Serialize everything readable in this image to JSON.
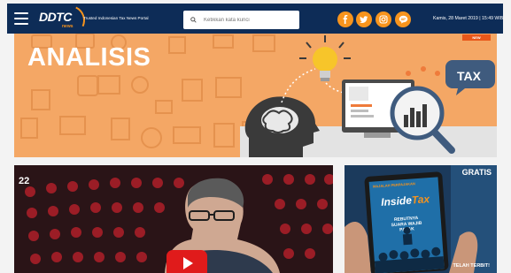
{
  "header": {
    "logo_text": "DDTC",
    "logo_sub": "news",
    "tagline": "Trusted Indonesian Tax News Portal",
    "search_placeholder": "Ketikkan kata kunci",
    "datetime": "Kamis, 28 Maret 2019 | 15:49 WIB",
    "social": [
      "facebook-icon",
      "twitter-icon",
      "instagram-icon",
      "line-icon"
    ]
  },
  "banner": {
    "title": "ANALISIS",
    "badge": "NEW",
    "tax_bubble": "TAX"
  },
  "video": {
    "episode": "22"
  },
  "ad": {
    "gratis": "GRATIS",
    "magazine_tag": "MAJALAH PERPAJAKAN",
    "brand_main": "Inside",
    "brand_accent": "Tax",
    "headline": "REBUTNYA SUARA WAJIB PAJAK",
    "terbit": "TELAH TERBIT!"
  },
  "colors": {
    "header_bg": "#0d2c57",
    "accent": "#f7941d",
    "banner_bg": "#f4a765",
    "play": "#e01b1b"
  }
}
